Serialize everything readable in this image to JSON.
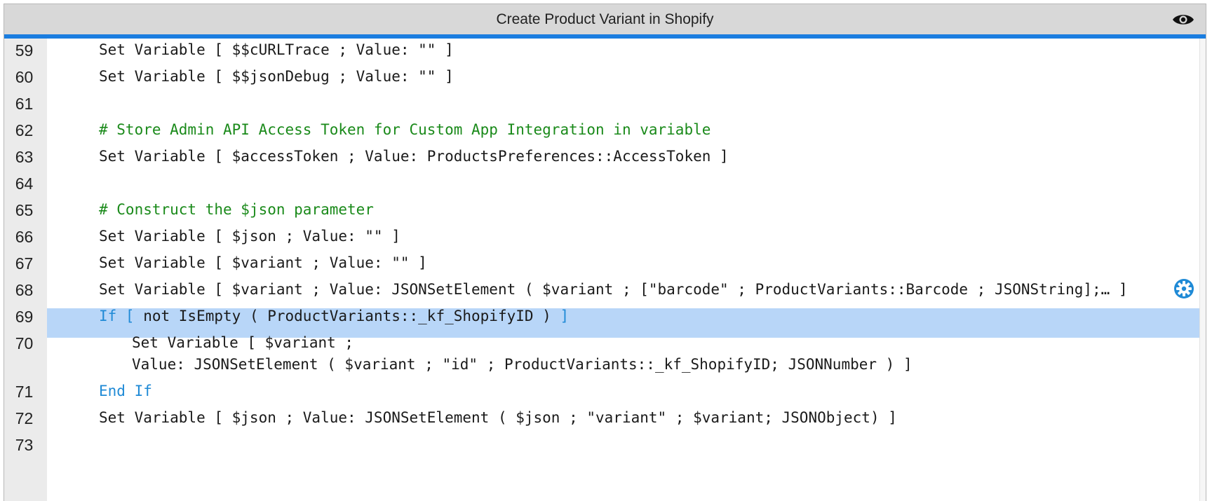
{
  "window": {
    "title": "Create Product Variant in Shopify"
  },
  "lines": [
    {
      "num": "59",
      "code": "Set Variable [ $$cURLTrace ; Value: \"\" ]"
    },
    {
      "num": "60",
      "code": "Set Variable [ $$jsonDebug ; Value: \"\" ]"
    },
    {
      "num": "61",
      "code": ""
    },
    {
      "num": "62",
      "comment": "# Store Admin API Access Token for Custom App Integration in variable"
    },
    {
      "num": "63",
      "code": "Set Variable [ $accessToken ; Value: ProductsPreferences::AccessToken ]"
    },
    {
      "num": "64",
      "code": ""
    },
    {
      "num": "65",
      "comment": "# Construct the $json parameter"
    },
    {
      "num": "66",
      "code": "Set Variable [ $json ; Value: \"\" ]"
    },
    {
      "num": "67",
      "code": "Set Variable [ $variant ; Value: \"\" ]"
    },
    {
      "num": "68",
      "code": "Set Variable [ $variant ; Value: JSONSetElement ( $variant ; [\"barcode\" ; ProductVariants::Barcode ; JSONString];… ]"
    },
    {
      "num": "69",
      "kw_open": "If [",
      "code": " not IsEmpty ( ProductVariants::_kf_ShopifyID ) ",
      "kw_close": "]"
    },
    {
      "num": "70",
      "code": "Set Variable [ $variant ;",
      "code2": "Value: JSONSetElement ( $variant ; \"id\" ; ProductVariants::_kf_ShopifyID; JSONNumber ) ]"
    },
    {
      "num": "71",
      "kw": "End If"
    },
    {
      "num": "72",
      "code": "Set Variable [ $json ; Value: JSONSetElement ( $json ; \"variant\" ; $variant; JSONObject) ]"
    },
    {
      "num": "73",
      "code": ""
    }
  ],
  "selected_line": "68",
  "colors": {
    "accent": "#1a7de0",
    "selection": "#b8d6f8",
    "keyword": "#1f8ad6",
    "comment": "#1a8a1a"
  },
  "icons": {
    "view": "eye-icon",
    "step_options": "gear-icon"
  }
}
